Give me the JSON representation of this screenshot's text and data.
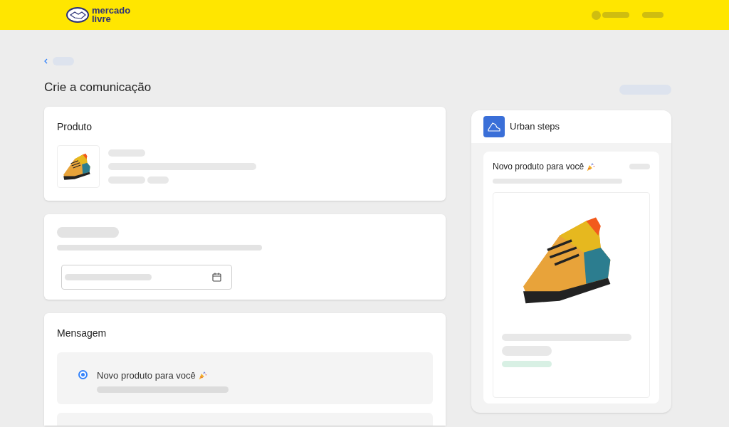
{
  "header": {
    "logo_line_1": "mercado",
    "logo_line_2": "livre"
  },
  "page": {
    "title": "Crie a comunicação"
  },
  "product_card": {
    "title": "Produto"
  },
  "message_card": {
    "title": "Mensagem",
    "options": [
      {
        "label": "Novo produto para você",
        "selected": true
      }
    ]
  },
  "preview": {
    "store_name": "Urban steps",
    "message_title": "Novo produto para você"
  }
}
